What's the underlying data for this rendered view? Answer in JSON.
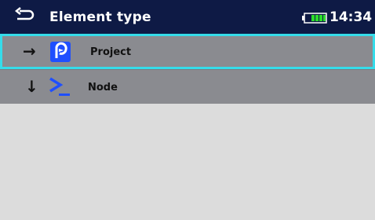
{
  "header": {
    "title": "Element type",
    "back_icon": "back-arrow-icon",
    "battery_icon": "battery-icon",
    "clock": "14:34"
  },
  "list": {
    "items": [
      {
        "label": "Project",
        "arrow": "→",
        "icon": "project-icon",
        "selected": true
      },
      {
        "label": "Node",
        "arrow": "↓",
        "icon": "node-icon",
        "selected": false
      }
    ]
  },
  "colors": {
    "header_bg": "#0e1a45",
    "row_bg": "#8a8b90",
    "selection_border": "#35dcea",
    "body_bg": "#dcdcdc",
    "icon_blue": "#1f4fff",
    "battery_green": "#2bdc2b"
  }
}
